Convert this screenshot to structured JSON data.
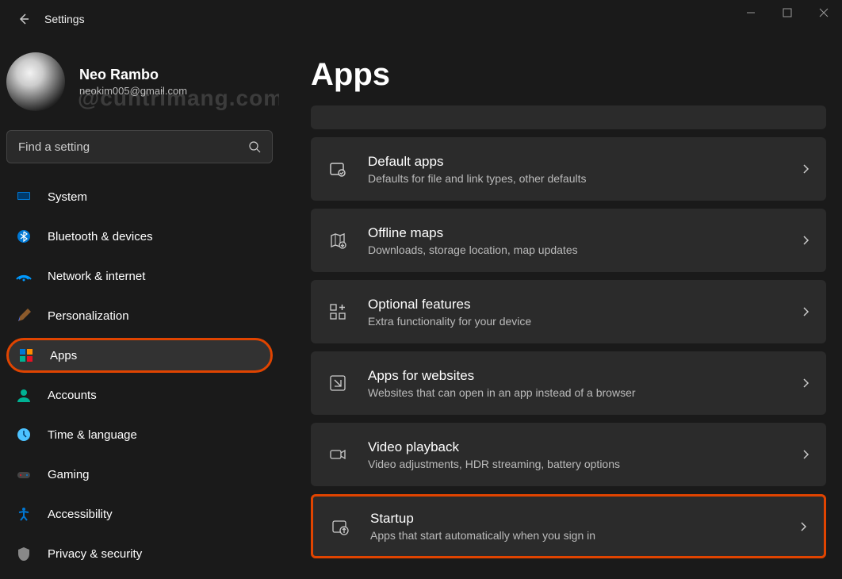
{
  "window": {
    "title": "Settings"
  },
  "user": {
    "name": "Neo Rambo",
    "email": "neokim005@gmail.com",
    "watermark": "@cuntrimang.com"
  },
  "search": {
    "placeholder": "Find a setting"
  },
  "nav": {
    "items": [
      {
        "label": "System",
        "icon": "system"
      },
      {
        "label": "Bluetooth & devices",
        "icon": "bluetooth"
      },
      {
        "label": "Network & internet",
        "icon": "network"
      },
      {
        "label": "Personalization",
        "icon": "personalization"
      },
      {
        "label": "Apps",
        "icon": "apps",
        "active": true,
        "highlighted": true
      },
      {
        "label": "Accounts",
        "icon": "accounts"
      },
      {
        "label": "Time & language",
        "icon": "time"
      },
      {
        "label": "Gaming",
        "icon": "gaming"
      },
      {
        "label": "Accessibility",
        "icon": "accessibility"
      },
      {
        "label": "Privacy & security",
        "icon": "privacy"
      }
    ]
  },
  "page": {
    "title": "Apps",
    "cards": [
      {
        "title": "Default apps",
        "subtitle": "Defaults for file and link types, other defaults",
        "icon": "default-apps"
      },
      {
        "title": "Offline maps",
        "subtitle": "Downloads, storage location, map updates",
        "icon": "maps"
      },
      {
        "title": "Optional features",
        "subtitle": "Extra functionality for your device",
        "icon": "features"
      },
      {
        "title": "Apps for websites",
        "subtitle": "Websites that can open in an app instead of a browser",
        "icon": "websites"
      },
      {
        "title": "Video playback",
        "subtitle": "Video adjustments, HDR streaming, battery options",
        "icon": "video"
      },
      {
        "title": "Startup",
        "subtitle": "Apps that start automatically when you sign in",
        "icon": "startup",
        "highlighted": true
      }
    ]
  }
}
